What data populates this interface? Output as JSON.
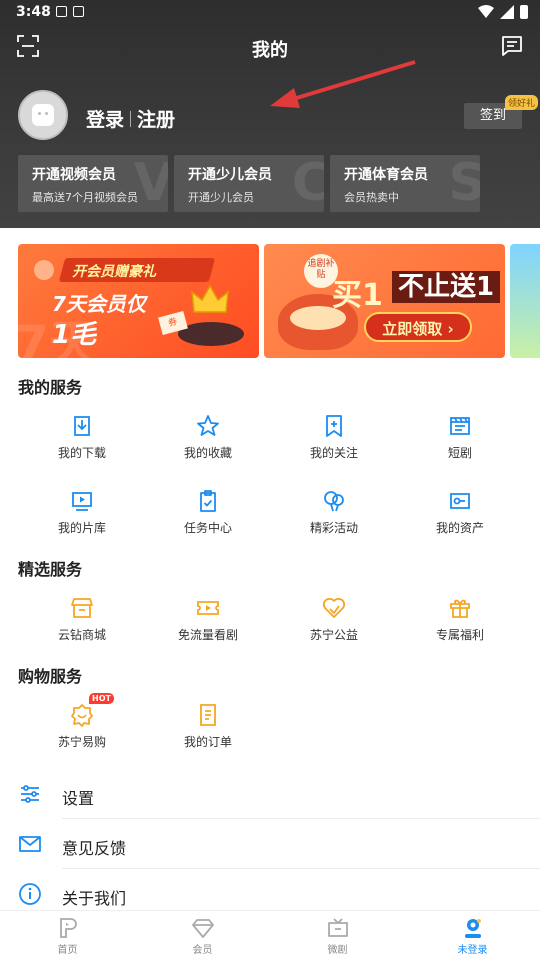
{
  "status_bar": {
    "time": "3:48"
  },
  "header": {
    "title": "我的"
  },
  "profile": {
    "login": "登录",
    "register": "注册",
    "signin_label": "签到",
    "gift_badge": "领好礼"
  },
  "vip_cards": [
    {
      "title": "开通视频会员",
      "subtitle": "最高送7个月视频会员",
      "mark": "V"
    },
    {
      "title": "开通少儿会员",
      "subtitle": "开通少儿会员",
      "mark": "C"
    },
    {
      "title": "开通体育会员",
      "subtitle": "会员热卖中",
      "mark": "S"
    }
  ],
  "banners": {
    "b1": {
      "head": "开会员赠豪礼",
      "line1": "7天会员仅",
      "line2": "1毛",
      "coupon": "券"
    },
    "b2": {
      "stamp": "追剧补贴",
      "buy": "买1",
      "more": "不止送1",
      "cta": "立即领取 ›"
    }
  },
  "sections": {
    "my_services": {
      "title": "我的服务",
      "items": [
        {
          "label": "我的下载",
          "icon": "download-icon"
        },
        {
          "label": "我的收藏",
          "icon": "star-icon"
        },
        {
          "label": "我的关注",
          "icon": "bookmark-icon"
        },
        {
          "label": "短剧",
          "icon": "clapper-icon"
        },
        {
          "label": "我的片库",
          "icon": "play-library-icon"
        },
        {
          "label": "任务中心",
          "icon": "clipboard-icon"
        },
        {
          "label": "精彩活动",
          "icon": "balloon-icon"
        },
        {
          "label": "我的资产",
          "icon": "wallet-icon"
        }
      ]
    },
    "featured_services": {
      "title": "精选服务",
      "items": [
        {
          "label": "云钻商城",
          "icon": "shop-icon"
        },
        {
          "label": "免流量看剧",
          "icon": "ticket-icon"
        },
        {
          "label": "苏宁公益",
          "icon": "heart-icon"
        },
        {
          "label": "专属福利",
          "icon": "gift-icon"
        }
      ]
    },
    "shopping_services": {
      "title": "购物服务",
      "items": [
        {
          "label": "苏宁易购",
          "icon": "badge-icon",
          "hot": "HOT"
        },
        {
          "label": "我的订单",
          "icon": "order-icon"
        }
      ]
    }
  },
  "list_rows": [
    {
      "label": "设置",
      "icon": "settings-icon"
    },
    {
      "label": "意见反馈",
      "icon": "mail-icon"
    },
    {
      "label": "关于我们",
      "icon": "info-icon"
    }
  ],
  "bottom_nav": [
    {
      "label": "首页",
      "icon": "home-icon"
    },
    {
      "label": "会员",
      "icon": "diamond-icon"
    },
    {
      "label": "微剧",
      "icon": "tv-icon"
    },
    {
      "label": "未登录",
      "icon": "user-icon",
      "active": true
    }
  ],
  "colors": {
    "accent_blue": "#1b8cf0",
    "icon_orange": "#f5a623",
    "header_dark": "#3a3a3a"
  }
}
